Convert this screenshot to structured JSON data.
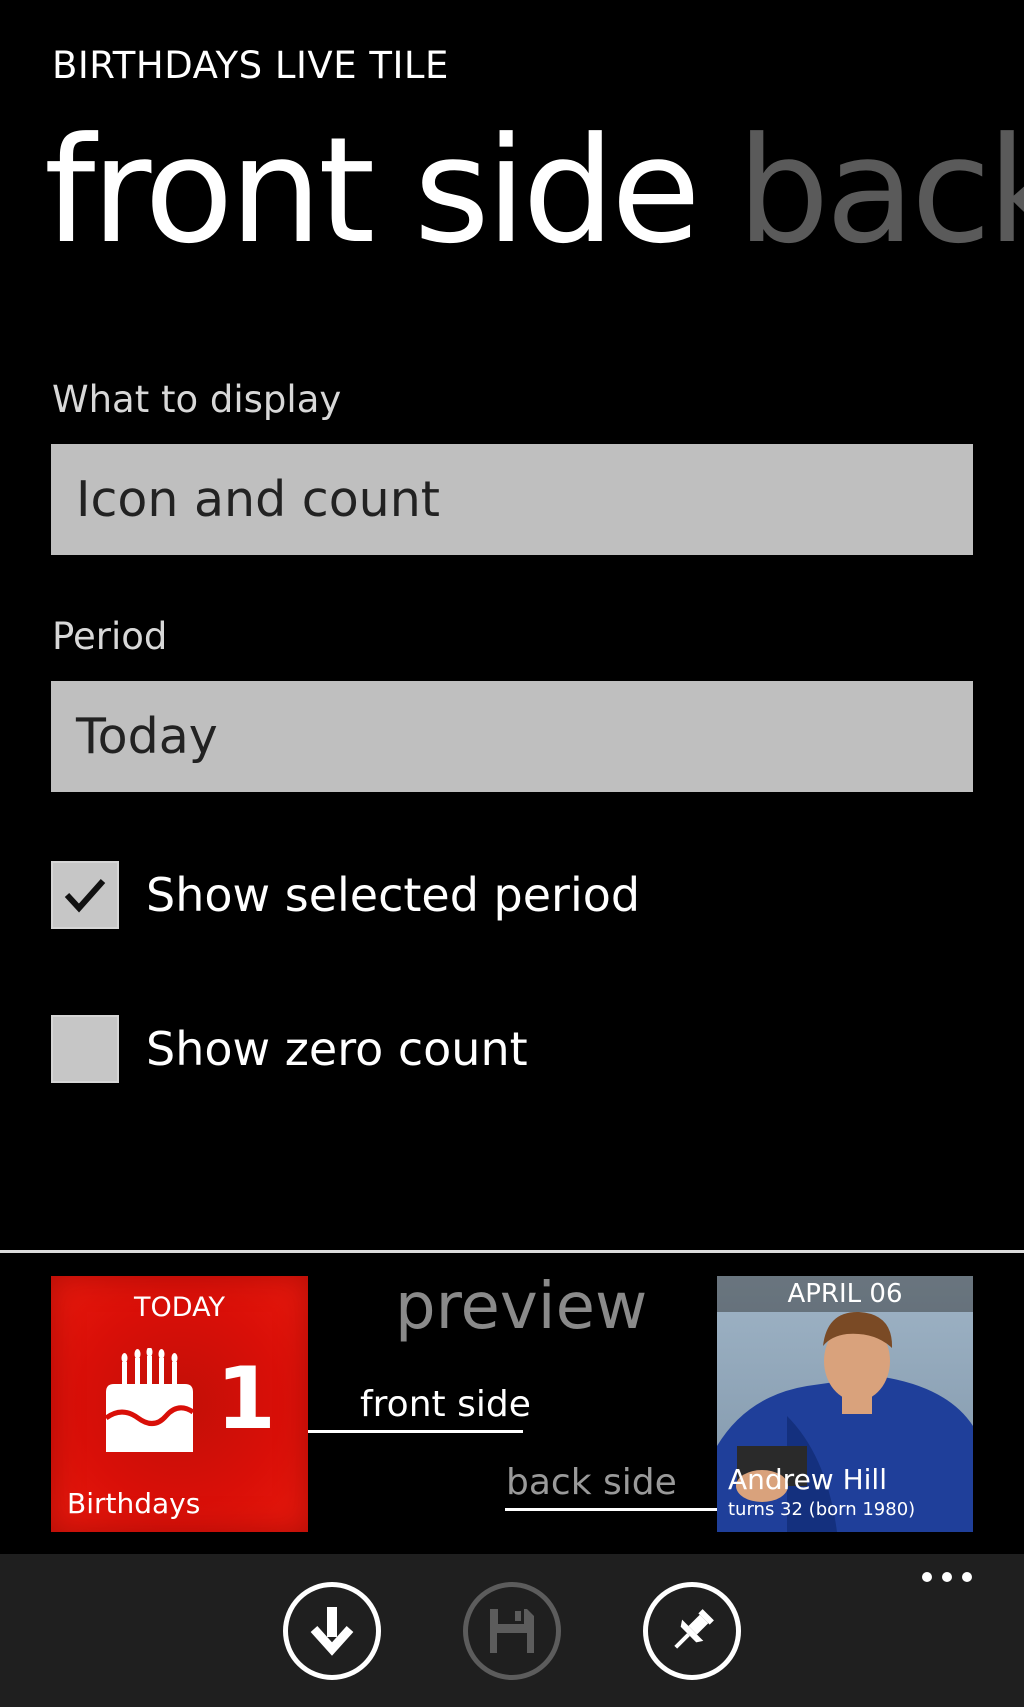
{
  "app": {
    "title": "BIRTHDAYS LIVE TILE"
  },
  "pivot": {
    "tabs": [
      {
        "label": "front side",
        "active": true
      },
      {
        "label": "back",
        "active": false
      }
    ]
  },
  "form": {
    "display": {
      "label": "What to display",
      "value": "Icon and count"
    },
    "period": {
      "label": "Period",
      "value": "Today"
    },
    "checkboxes": [
      {
        "label": "Show selected period",
        "checked": true
      },
      {
        "label": "Show zero count",
        "checked": false
      }
    ]
  },
  "preview": {
    "label": "preview",
    "front_link": "front side",
    "back_link": "back side",
    "front_tile": {
      "top_text": "TODAY",
      "count": "1",
      "name": "Birthdays",
      "color": "#e0140a",
      "icon": "birthday-cake-icon"
    },
    "back_tile": {
      "date": "APRIL 06",
      "person_name": "Andrew Hill",
      "subtitle": "turns 32 (born 1980)"
    }
  },
  "app_bar": {
    "buttons": [
      {
        "icon": "download-icon",
        "enabled": true
      },
      {
        "icon": "save-icon",
        "enabled": false
      },
      {
        "icon": "pin-icon",
        "enabled": true
      }
    ],
    "more": "more-icon"
  }
}
